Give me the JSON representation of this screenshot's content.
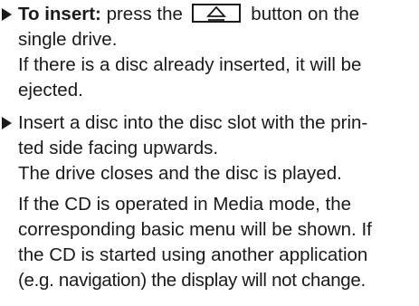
{
  "step1": {
    "lead_bold": "To insert:",
    "lead_text_before_key": " press the",
    "key_icon": "eject-icon",
    "lead_text_after_key": " button on the",
    "line2": "single drive.",
    "line3": "If there is a disc already inserted, it will be",
    "line4": "ejected."
  },
  "step2": {
    "line1": "Insert a disc into the disc slot with the prin-",
    "line2": "ted side facing upwards.",
    "line3": "The drive closes and the disc is played."
  },
  "note": {
    "line1": "If the CD is operated in Media mode, the",
    "line2": "corresponding basic menu will be shown. If",
    "line3": "the CD is started using another application",
    "line4": "(e.g. navigation) the display will not change."
  }
}
